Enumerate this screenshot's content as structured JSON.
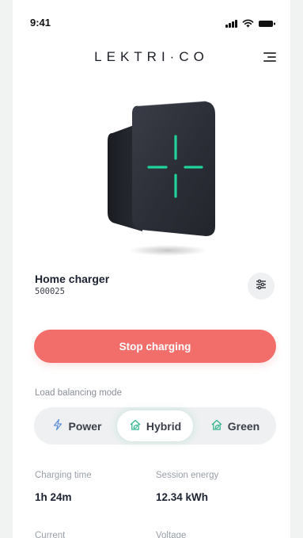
{
  "status_bar": {
    "time": "9:41",
    "icons": [
      "signal-icon",
      "wifi-icon",
      "battery-icon"
    ]
  },
  "header": {
    "brand": "LEKTRI·CO",
    "menu_icon": "menu-icon"
  },
  "device": {
    "name": "Home charger",
    "id": "500025",
    "settings_icon": "sliders-icon"
  },
  "actions": {
    "stop_label": "Stop charging"
  },
  "load_balancing": {
    "label": "Load balancing mode",
    "selected": "Hybrid",
    "options": [
      {
        "label": "Power",
        "icon": "bolt-icon"
      },
      {
        "label": "Hybrid",
        "icon": "house-leaf-icon"
      },
      {
        "label": "Green",
        "icon": "house-leaf-icon"
      }
    ]
  },
  "stats": [
    {
      "label": "Charging time",
      "value": "1h 24m"
    },
    {
      "label": "Session energy",
      "value": "12.34 kWh"
    },
    {
      "label": "Current",
      "value": ""
    },
    {
      "label": "Voltage",
      "value": ""
    }
  ],
  "colors": {
    "accent_red": "#f26e6b",
    "accent_green": "#2eb28c",
    "power_blue": "#5b8ed8",
    "device_body": "#2b2e36",
    "led_green": "#1fd39a"
  }
}
